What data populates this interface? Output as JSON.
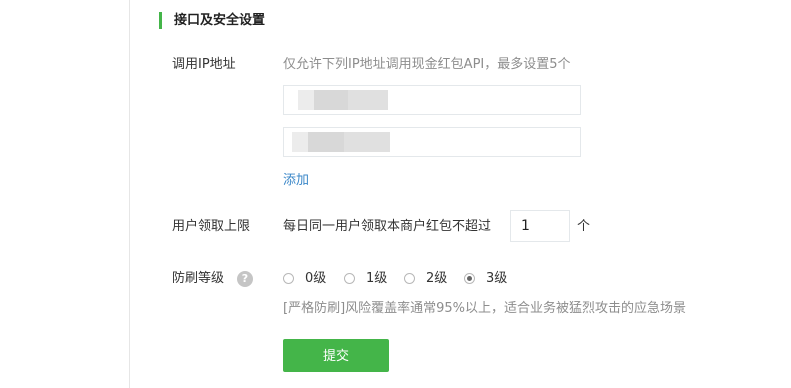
{
  "section": {
    "title": "接口及安全设置"
  },
  "ip": {
    "label": "调用IP地址",
    "hint": "仅允许下列IP地址调用现金红包API，最多设置5个",
    "entries": [
      "",
      ""
    ],
    "add_label": "添加"
  },
  "limit": {
    "label": "用户领取上限",
    "text": "每日同一用户领取本商户红包不超过",
    "value": "1",
    "unit": "个"
  },
  "security": {
    "label": "防刷等级",
    "help_icon": "question-circle-icon",
    "options": [
      "0级",
      "1级",
      "2级",
      "3级"
    ],
    "selected": "3级",
    "description": "[严格防刷]风险覆盖率通常95%以上，适合业务被猛烈攻击的应急场景"
  },
  "submit": {
    "label": "提交"
  },
  "colors": {
    "accent": "#44b549",
    "link": "#3b87c8",
    "hint": "#8d8d8d"
  }
}
